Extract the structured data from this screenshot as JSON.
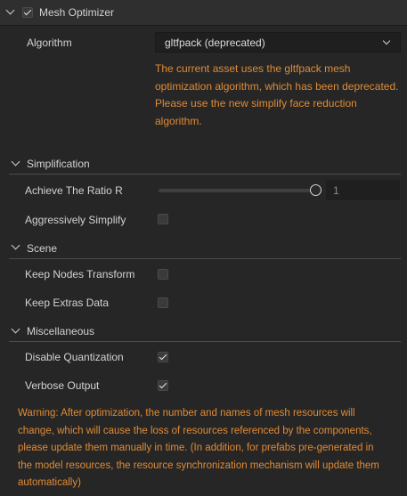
{
  "header": {
    "title": "Mesh Optimizer",
    "enabled": true
  },
  "algorithm": {
    "label": "Algorithm",
    "value": "gltfpack (deprecated)",
    "warning_lines": [
      "The current asset uses the gltfpack mesh",
      "optimization algorithm, which has been deprecated.",
      "Please use the new simplify face reduction",
      "algorithm."
    ]
  },
  "simplification": {
    "title": "Simplification",
    "ratio_label": "Achieve The Ratio R",
    "ratio_value": "1",
    "ratio_slider_fraction": 1,
    "aggressive_label": "Aggressively Simplify",
    "aggressive_checked": false
  },
  "scene": {
    "title": "Scene",
    "keep_nodes_label": "Keep Nodes Transform",
    "keep_nodes_checked": false,
    "keep_extras_label": "Keep Extras Data",
    "keep_extras_checked": false
  },
  "misc": {
    "title": "Miscellaneous",
    "disable_quant_label": "Disable Quantization",
    "disable_quant_checked": true,
    "verbose_label": "Verbose Output",
    "verbose_checked": true
  },
  "footer_warning_lines": [
    "Warning: After optimization, the number and names of mesh resources will",
    "change, which will cause the loss of resources referenced by the components,",
    "please update them manually in time. (In addition, for prefabs pre-generated in",
    "the model resources, the resource synchronization mechanism will update them",
    "automatically)"
  ],
  "colors": {
    "warning": "#e08a34",
    "background": "#262626"
  }
}
